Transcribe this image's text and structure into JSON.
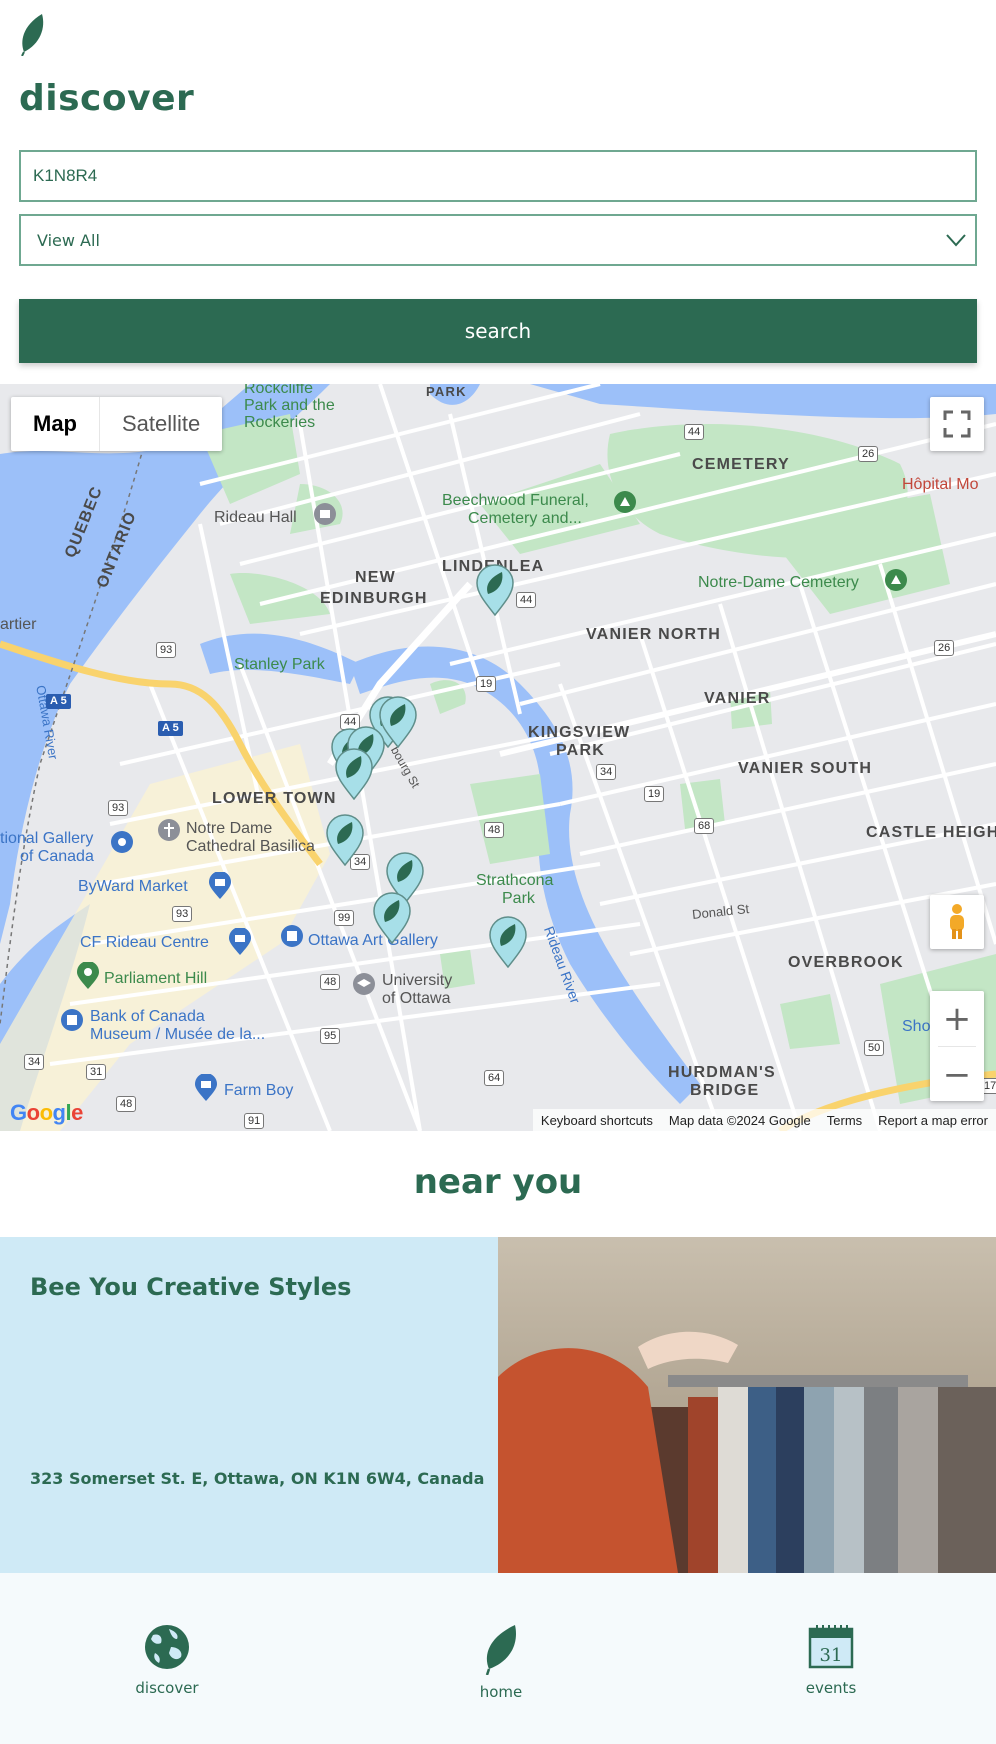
{
  "header": {
    "logo_icon": "leaf-icon",
    "title": "discover"
  },
  "search": {
    "value": "K1N8R4",
    "placeholder": ""
  },
  "filter": {
    "selected": "View All"
  },
  "search_button": {
    "label": "search"
  },
  "map": {
    "type_controls": {
      "map": "Map",
      "satellite": "Satellite"
    },
    "neighborhoods": {
      "park": "PARK",
      "cemetery": "CEMETERY",
      "new_edinburgh_1": "NEW",
      "new_edinburgh_2": "EDINBURGH",
      "lindenlea": "LINDENLEA",
      "vanier_north": "VANIER NORTH",
      "vanier": "VANIER",
      "kingsview_1": "KINGSVIEW",
      "kingsview_2": "PARK",
      "vanier_south": "VANIER SOUTH",
      "lower_town": "LOWER TOWN",
      "castle_heights": "CASTLE HEIGH",
      "overbrook": "OVERBROOK",
      "hurdmans_1": "HURDMAN'S",
      "hurdmans_2": "BRIDGE",
      "quebec": "QUEBEC",
      "ontario": "ONTARIO"
    },
    "places": {
      "rockcliffe_1": "Rockcliffe",
      "rockcliffe_2": "Park and the",
      "rockcliffe_3": "Rockeries",
      "rideau_hall": "Rideau Hall",
      "beechwood_1": "Beechwood Funeral,",
      "beechwood_2": "Cemetery and...",
      "hopital": "Hôpital Mo",
      "notre_dame_cemetery": "Notre-Dame Cemetery",
      "cartier": "artier",
      "stanley_park": "Stanley Park",
      "ottawa_river": "Ottawa River",
      "basilica_1": "Notre Dame",
      "basilica_2": "Cathedral Basilica",
      "gallery_1": "tional Gallery",
      "gallery_2": "of Canada",
      "byward": "ByWard Market",
      "cf_rideau": "CF Rideau Centre",
      "art_gallery": "Ottawa Art Gallery",
      "strathcona_1": "Strathcona",
      "strathcona_2": "Park",
      "parliament": "Parliament Hill",
      "uottawa_1": "University",
      "uottawa_2": "of Ottawa",
      "bank_1": "Bank of Canada",
      "bank_2": "Museum / Musée de la...",
      "farm_boy": "Farm Boy",
      "rideau_river": "Rideau River",
      "donald_st": "Donald St",
      "bourg_st": "bourg St",
      "sho": "Sho"
    },
    "shields": {
      "r44a": "44",
      "r26a": "26",
      "r44b": "44",
      "r26b": "26",
      "r93a": "93",
      "a5a": "A 5",
      "a5b": "A 5",
      "r19a": "19",
      "r44c": "44",
      "r34a": "34",
      "r19b": "19",
      "r93b": "93",
      "r48a": "48",
      "r68": "68",
      "r34b": "34",
      "r93c": "93",
      "r99": "99",
      "r48b": "48",
      "r95": "95",
      "r50": "50",
      "r34c": "34",
      "r31": "31",
      "r48c": "48",
      "r64": "64",
      "r91": "91",
      "r17": "17"
    },
    "google_logo": "Google",
    "attribution": {
      "shortcuts": "Keyboard shortcuts",
      "data": "Map data ©2024 Google",
      "terms": "Terms",
      "report": "Report a map error"
    },
    "controls": {
      "zoom_in": "+",
      "zoom_out": "−"
    }
  },
  "near_you": {
    "title": "near you",
    "card": {
      "name": "Bee You Creative Styles",
      "address": "323 Somerset St. E, Ottawa, ON K1N 6W4, Canada"
    }
  },
  "nav": {
    "items": [
      {
        "label": "discover",
        "icon": "globe-icon"
      },
      {
        "label": "home",
        "icon": "leaf-icon"
      },
      {
        "label": "events",
        "icon": "calendar-icon"
      }
    ],
    "calendar_day": "31"
  },
  "colors": {
    "brand": "#2c6a52",
    "card_bg": "#cfeaf6",
    "water": "#9cc0f9",
    "park": "#c3e6c5",
    "road": "#ffffff",
    "highway": "#f9d36d"
  }
}
